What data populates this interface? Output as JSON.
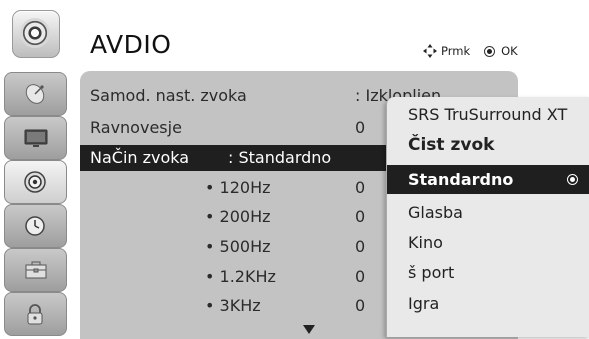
{
  "header": {
    "title": "AVDIO",
    "hint_move": "Prmk",
    "hint_ok": "OK"
  },
  "sidebar": {
    "items": [
      {
        "icon": "satellite-dish-icon"
      },
      {
        "icon": "tv-screen-icon"
      },
      {
        "icon": "speaker-icon",
        "active": true
      },
      {
        "icon": "clock-icon"
      },
      {
        "icon": "toolbox-icon"
      },
      {
        "icon": "lock-icon"
      }
    ]
  },
  "menu": {
    "rows": [
      {
        "label": "Samod. nast. zvoka",
        "value": ": Izklopljen"
      },
      {
        "label": "Ravnovesje",
        "value": "0"
      },
      {
        "label": "NaČin zvoka",
        "value": ": Standardno"
      }
    ],
    "eq": [
      {
        "freq": "• 120Hz",
        "value": "0"
      },
      {
        "freq": "• 200Hz",
        "value": "0"
      },
      {
        "freq": "• 500Hz",
        "value": "0"
      },
      {
        "freq": "• 1.2KHz",
        "value": "0"
      },
      {
        "freq": "• 3KHz",
        "value": "0"
      }
    ]
  },
  "popup": {
    "options": [
      {
        "label": "SRS TruSurround XT"
      },
      {
        "label": "Čist zvok"
      },
      {
        "label": "Standardno",
        "selected": true
      },
      {
        "label": "Glasba"
      },
      {
        "label": "Kino"
      },
      {
        "label": "š port"
      },
      {
        "label": "Igra"
      }
    ]
  },
  "colors": {
    "panel": "#c3c3c3",
    "highlight": "#1f1f1f",
    "popup": "#e9e9e9"
  }
}
